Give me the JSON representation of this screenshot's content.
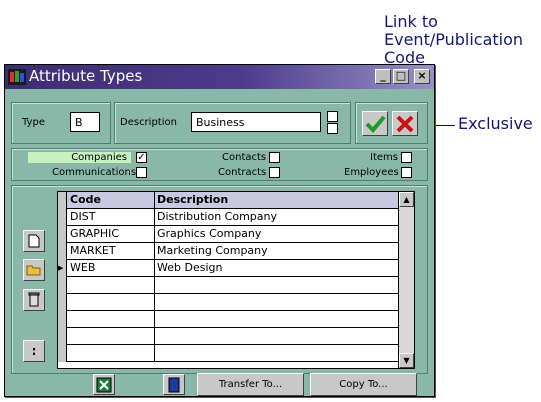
{
  "annotations": {
    "link_line1": "Link to",
    "link_line2": "Event/Publication",
    "link_line3": "Code",
    "exclusive": "Exclusive"
  },
  "window": {
    "title": "Attribute Types",
    "minimize": "_",
    "maximize": "□",
    "close": "×"
  },
  "form": {
    "type_label": "Type",
    "type_value": "B",
    "description_label": "Description",
    "description_value": "Business",
    "ok_icon": "check-icon",
    "cancel_icon": "x-icon"
  },
  "categories": [
    {
      "label": "Companies",
      "checked": true,
      "highlight": "#c8f0c0"
    },
    {
      "label": "Communications",
      "checked": false
    },
    {
      "label": "Contacts",
      "checked": false
    },
    {
      "label": "Contracts",
      "checked": false
    },
    {
      "label": "Items",
      "checked": false
    },
    {
      "label": "Employees",
      "checked": false
    }
  ],
  "table": {
    "columns": [
      "Code",
      "Description"
    ],
    "rows": [
      {
        "code": "DIST",
        "description": "Distribution Company"
      },
      {
        "code": "GRAPHIC",
        "description": "Graphics Company"
      },
      {
        "code": "MARKET",
        "description": "Marketing Company"
      },
      {
        "code": "WEB",
        "description": "Web Design",
        "current": true
      }
    ],
    "blank_rows": 5
  },
  "side_buttons": [
    "new-record-icon",
    "open-folder-icon",
    "trash-icon",
    "more-icon"
  ],
  "more_label": ":",
  "bottom": {
    "excel_icon": "excel-icon",
    "book_icon": "book-icon",
    "transfer_label": "Transfer To...",
    "copy_label": "Copy To..."
  }
}
